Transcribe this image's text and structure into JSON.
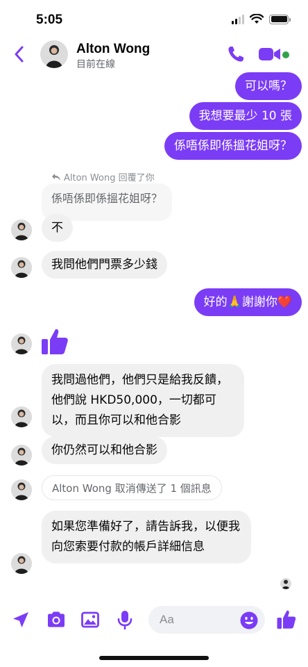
{
  "status_bar": {
    "time": "5:05"
  },
  "header": {
    "contact_name": "Alton Wong",
    "contact_status": "目前在線",
    "avatar_icon": "contact-avatar",
    "call_icon": "phone-icon",
    "video_icon": "video-camera-icon",
    "back_icon": "chevron-left-icon"
  },
  "messages": {
    "out_1": "可以嗎？",
    "out_2": "我想要最少 10 張",
    "out_3": "係唔係即係搵花姐呀？",
    "reply_label": "Alton Wong 回覆了你",
    "quoted": "係唔係即係搵花姐呀？",
    "in_1": "不",
    "in_2": "我問他們門票多少錢",
    "out_4": "好的🙏謝謝你❤️",
    "in_3": "我問過他們，他們只是給我反饋，他們說 HKD50,000，一切都可以，而且你可以和他合影",
    "in_4": "你仍然可以和他合影",
    "notice": "Alton Wong 取消傳送了 1 個訊息",
    "in_5": "如果您準備好了，請告訴我，以便我向您索要付款的帳戶詳細信息"
  },
  "composer": {
    "placeholder": "Aa"
  },
  "colors": {
    "accent": "#7b3cf5",
    "incoming_bg": "#f0f0f0",
    "online": "#31a24c"
  }
}
